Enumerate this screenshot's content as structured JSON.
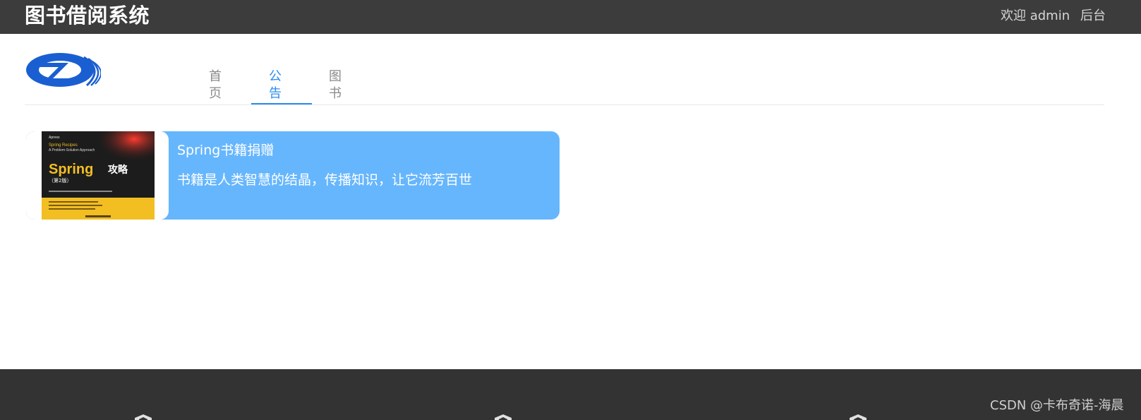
{
  "header": {
    "app_title": "图书借阅系统",
    "welcome_text": "欢迎 admin",
    "admin_link": "后台"
  },
  "nav": {
    "tabs": [
      {
        "label": "首页",
        "active": false
      },
      {
        "label": "公告",
        "active": true
      },
      {
        "label": "图书",
        "active": false
      }
    ]
  },
  "notices": [
    {
      "title": "Spring书籍捐赠",
      "description": "书籍是人类智慧的结晶，传播知识，让它流芳百世",
      "cover": {
        "publisher": "Apress",
        "series": "Spring Recipes",
        "subtitle": "A Problem-Solution Approach",
        "title_en": "Spring",
        "title_cn": "攻略",
        "edition": "（第2版）"
      }
    }
  ],
  "footer": {
    "watermark": "CSDN @卡布奇诺-海晨"
  },
  "colors": {
    "topbar": "#3c3c3c",
    "accent": "#2b8cf2",
    "card": "#66b6fd",
    "footer": "#333333"
  }
}
